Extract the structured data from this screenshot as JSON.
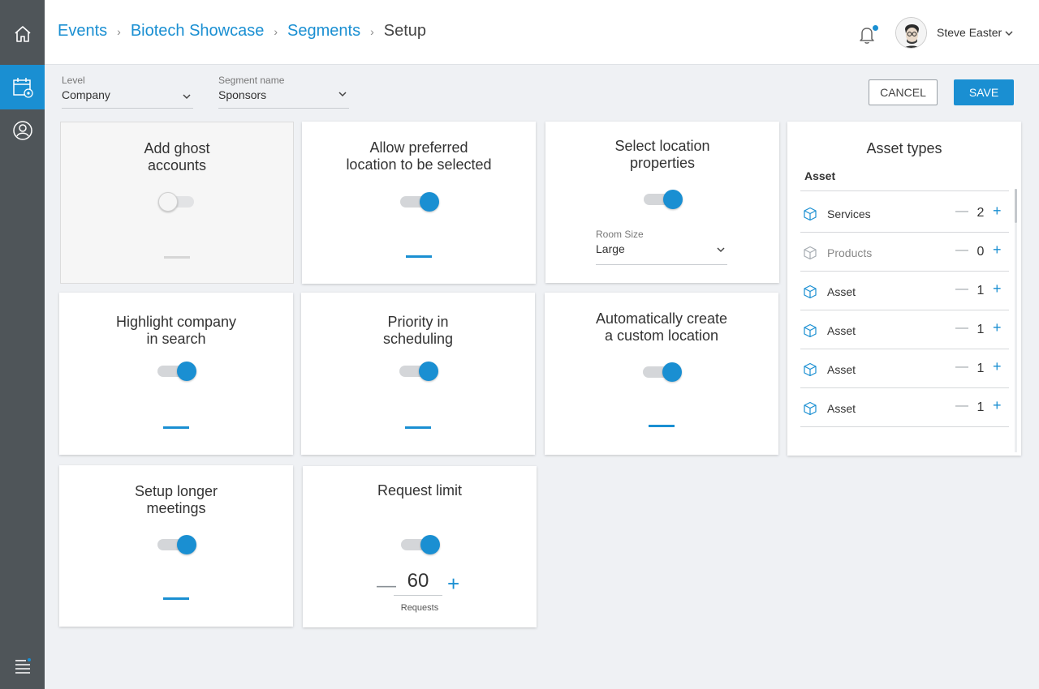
{
  "breadcrumb": {
    "items": [
      "Events",
      "Biotech Showcase",
      "Segments"
    ],
    "current": "Setup"
  },
  "user": {
    "name": "Steve Easter"
  },
  "filters": {
    "level": {
      "label": "Level",
      "value": "Company"
    },
    "segment": {
      "label": "Segment name",
      "value": "Sponsors"
    }
  },
  "actions": {
    "cancel": "CANCEL",
    "save": "SAVE"
  },
  "cards": {
    "ghost": {
      "title": "Add ghost\naccounts",
      "enabled": false
    },
    "preferred": {
      "title": "Allow preferred\nlocation to be selected",
      "enabled": true
    },
    "location": {
      "title": "Select location\nproperties",
      "enabled": true,
      "room_size_label": "Room Size",
      "room_size_value": "Large"
    },
    "highlight": {
      "title": "Highlight company\nin search",
      "enabled": true
    },
    "priority": {
      "title": "Priority in\nscheduling",
      "enabled": true
    },
    "auto_location": {
      "title": "Automatically create\na custom location",
      "enabled": true
    },
    "longer": {
      "title": "Setup longer\nmeetings",
      "enabled": true
    },
    "request_limit": {
      "title": "Request limit",
      "enabled": true,
      "value": "60",
      "unit": "Requests"
    }
  },
  "asset_types": {
    "title": "Asset types",
    "header": "Asset",
    "rows": [
      {
        "name": "Services",
        "count": "2"
      },
      {
        "name": "Products",
        "count": "0"
      },
      {
        "name": "Asset",
        "count": "1"
      },
      {
        "name": "Asset",
        "count": "1"
      },
      {
        "name": "Asset",
        "count": "1"
      },
      {
        "name": "Asset",
        "count": "1"
      }
    ]
  },
  "colors": {
    "accent": "#1a8fd2",
    "sidebar": "#4f5559",
    "background": "#eff1f4"
  }
}
